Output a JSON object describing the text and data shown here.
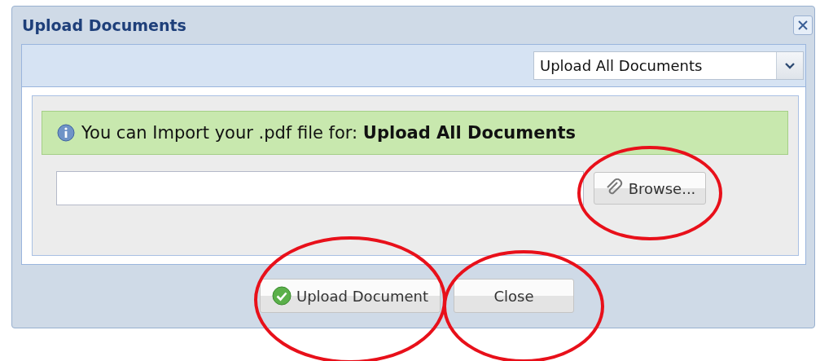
{
  "window": {
    "title": "Upload Documents"
  },
  "document_type": {
    "value": "Upload All Documents"
  },
  "message": {
    "text": "You can Import your .pdf file for: **Upload All Documents**"
  },
  "browse_button": {
    "label": "Browse..."
  },
  "buttons": [
    {
      "label": "Upload Document",
      "kind": "confirm"
    },
    {
      "label": "Close",
      "kind": "plain"
    }
  ]
}
